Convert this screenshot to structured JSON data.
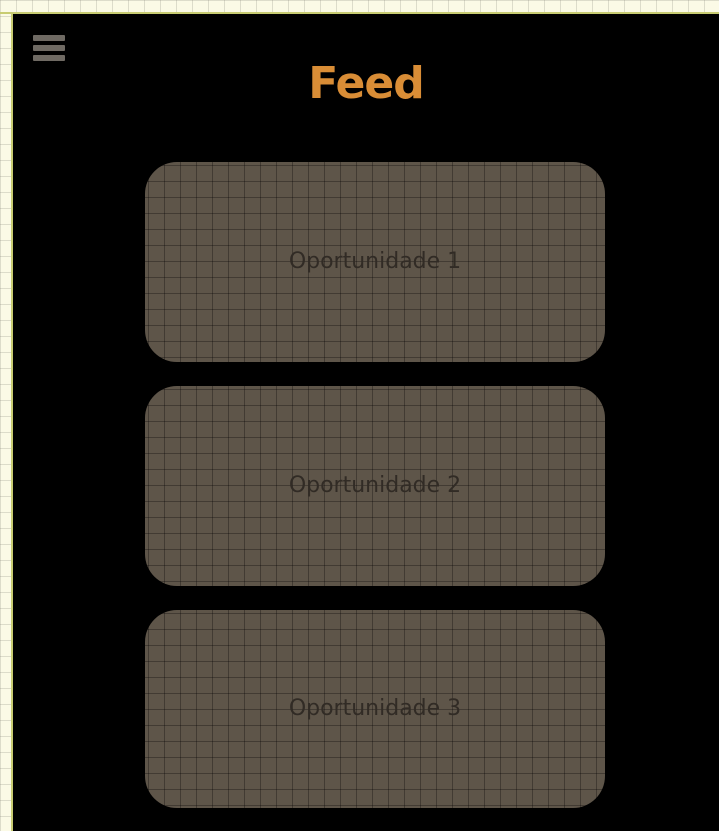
{
  "app": {
    "title": "Feed"
  },
  "header": {
    "menu_icon": "hamburger-menu-icon"
  },
  "feed": {
    "items": [
      {
        "label": "Oportunidade 1"
      },
      {
        "label": "Oportunidade 2"
      },
      {
        "label": "Oportunidade 3"
      }
    ]
  },
  "colors": {
    "background": "#000000",
    "title": "#d98d36",
    "menu_icon": "#6f6a63",
    "card_background": "#5e5549",
    "card_text": "#312b25",
    "guide_line": "#c8cc72"
  }
}
